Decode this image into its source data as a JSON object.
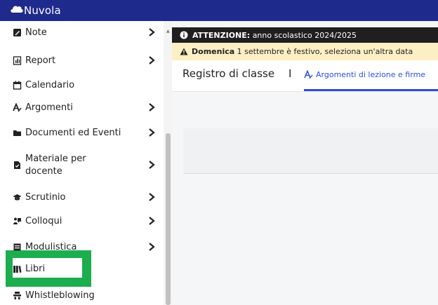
{
  "app": {
    "title": "Nuvola"
  },
  "sidebar": {
    "items": [
      {
        "label": "Note",
        "icon": "note-icon",
        "chevron": true
      },
      {
        "label": "Report",
        "icon": "report-icon",
        "chevron": true
      },
      {
        "label": "Calendario",
        "icon": "calendar-icon",
        "chevron": false
      },
      {
        "label": "Argomenti",
        "icon": "argomenti-icon",
        "chevron": true
      },
      {
        "label": "Documenti ed Eventi",
        "icon": "folder-icon",
        "chevron": true
      },
      {
        "label": "Materiale per docente",
        "label_line1": "Materiale per",
        "label_line2": "docente",
        "icon": "document-icon",
        "chevron": true
      },
      {
        "label": "Scrutinio",
        "icon": "graduation-cap-icon",
        "chevron": true
      },
      {
        "label": "Colloqui",
        "icon": "colloqui-icon",
        "chevron": true
      },
      {
        "label": "Modulistica",
        "icon": "form-icon",
        "chevron": true
      },
      {
        "label": "Libri",
        "icon": "books-icon",
        "chevron": false
      },
      {
        "label": "Whistleblowing",
        "icon": "whistleblowing-icon",
        "chevron": false
      }
    ]
  },
  "alerts": {
    "attention_label": "ATTENZIONE:",
    "attention_text": "anno scolastico 2024/2025",
    "holiday_day": "Domenica",
    "holiday_text": "1 settembre è festivo, seleziona un'altra data"
  },
  "tabs": {
    "main": "Registro di classe",
    "separator": "I",
    "active": "Argomenti di lezione e firme"
  },
  "colors": {
    "topbar": "#1e2a8c",
    "accent": "#2f4fd6",
    "highlight": "#1cae4e",
    "warning_bg": "#fdefc4",
    "alert_dark_bg": "#1f1f1f"
  }
}
